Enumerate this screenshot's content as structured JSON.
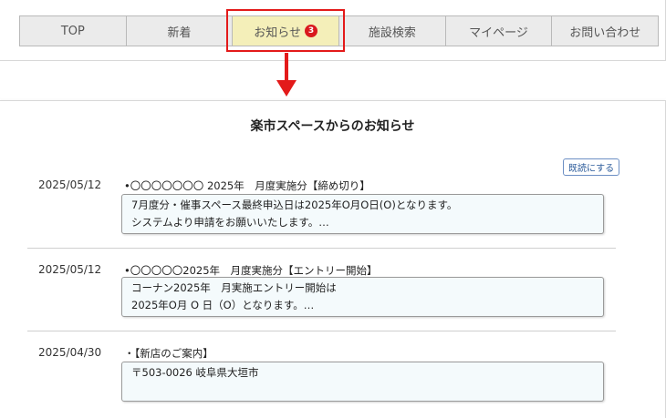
{
  "nav": {
    "items": [
      {
        "label": "TOP"
      },
      {
        "label": "新着"
      },
      {
        "label": "お知らせ",
        "badge": "3"
      },
      {
        "label": "施設検索"
      },
      {
        "label": "マイページ"
      },
      {
        "label": "お問い合わせ"
      }
    ]
  },
  "content": {
    "title": "楽市スペースからのお知らせ",
    "read_button": "既読にする",
    "entries": [
      {
        "date": "2025/05/12",
        "subject": "•〇〇〇〇〇〇〇 2025年　月度実施分【締め切り】",
        "lines": [
          "7月度分・催事スペース最終申込日は2025年O月O日(O)となります。",
          "システムより申請をお願いいたします。…"
        ]
      },
      {
        "date": "2025/05/12",
        "subject": "•〇〇〇〇〇2025年　月度実施分【エントリー開始】",
        "lines": [
          "コーナン2025年　月実施エントリー開始は",
          "2025年O月 O 日（O）となります。…"
        ]
      },
      {
        "date": "2025/04/30",
        "subject": "・【新店のご案内】",
        "lines": [
          "",
          "〒503-0026 岐阜県大垣市"
        ]
      }
    ]
  },
  "colors": {
    "highlight": "#e31a1a",
    "active_tab": "#f4efb9",
    "badge": "#d9181e"
  }
}
